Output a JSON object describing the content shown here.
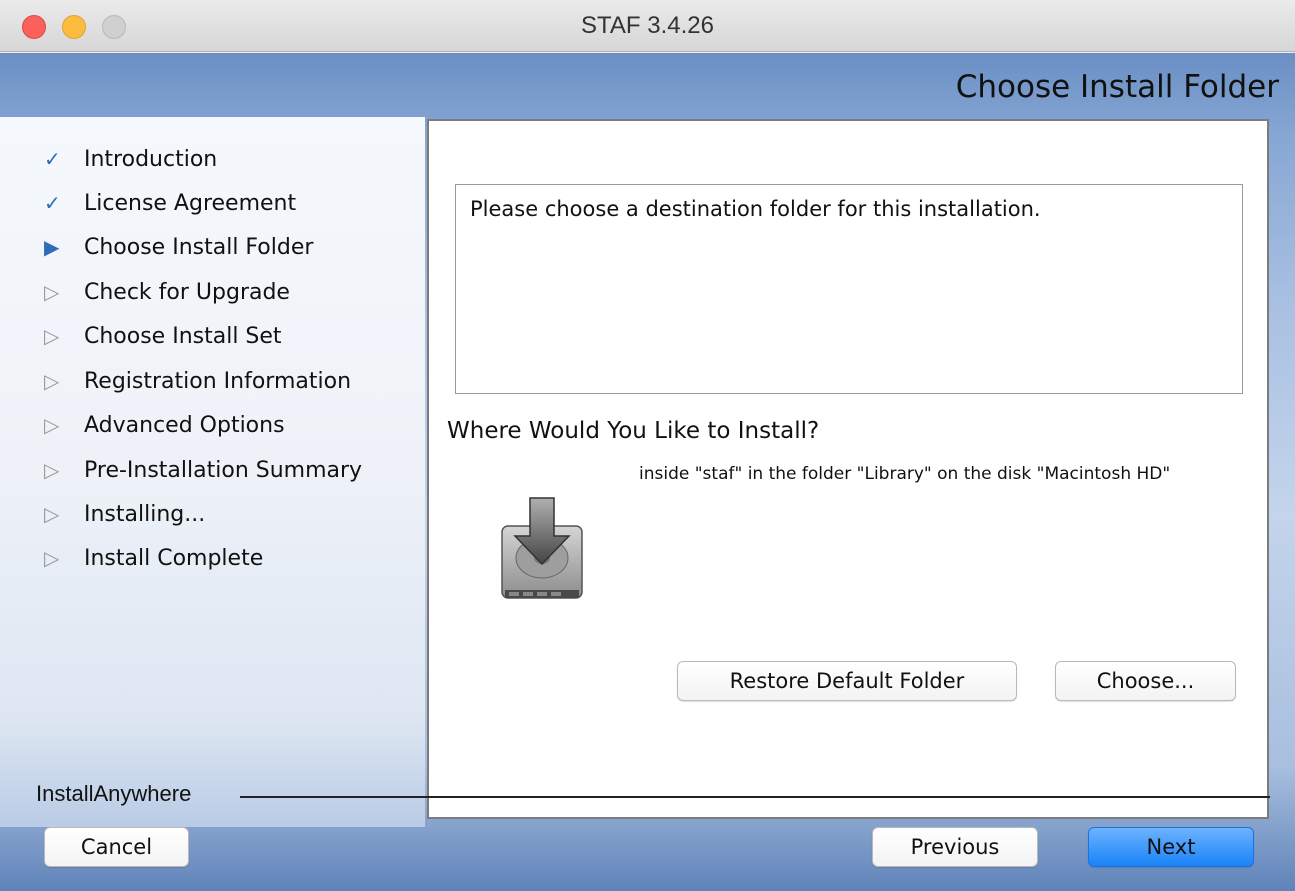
{
  "window": {
    "title": "STAF 3.4.26"
  },
  "page": {
    "heading": "Choose Install Folder"
  },
  "steps": [
    {
      "label": "Introduction",
      "state": "done",
      "icon": "checkmark-icon"
    },
    {
      "label": "License Agreement",
      "state": "done",
      "icon": "checkmark-icon"
    },
    {
      "label": "Choose Install Folder",
      "state": "current",
      "icon": "current-arrow-icon"
    },
    {
      "label": "Check for Upgrade",
      "state": "todo",
      "icon": "pending-arrow-icon"
    },
    {
      "label": "Choose Install Set",
      "state": "todo",
      "icon": "pending-arrow-icon"
    },
    {
      "label": "Registration Information",
      "state": "todo",
      "icon": "pending-arrow-icon"
    },
    {
      "label": "Advanced Options",
      "state": "todo",
      "icon": "pending-arrow-icon"
    },
    {
      "label": "Pre-Installation Summary",
      "state": "todo",
      "icon": "pending-arrow-icon"
    },
    {
      "label": "Installing...",
      "state": "todo",
      "icon": "pending-arrow-icon"
    },
    {
      "label": "Install Complete",
      "state": "todo",
      "icon": "pending-arrow-icon"
    }
  ],
  "content": {
    "message": "Please choose a destination folder for this installation.",
    "where_heading": "Where Would You Like to Install?",
    "install_path": "inside \"staf\" in the folder \"Library\" on the disk \"Macintosh HD\"",
    "restore_button": "Restore Default Folder",
    "choose_button": "Choose..."
  },
  "footer": {
    "brand": "InstallAnywhere",
    "cancel_button": "Cancel",
    "previous_button": "Previous",
    "next_button": "Next"
  },
  "colors": {
    "accent": "#1883f8",
    "step_done": "#2f6db8",
    "step_todo": "#999999"
  }
}
